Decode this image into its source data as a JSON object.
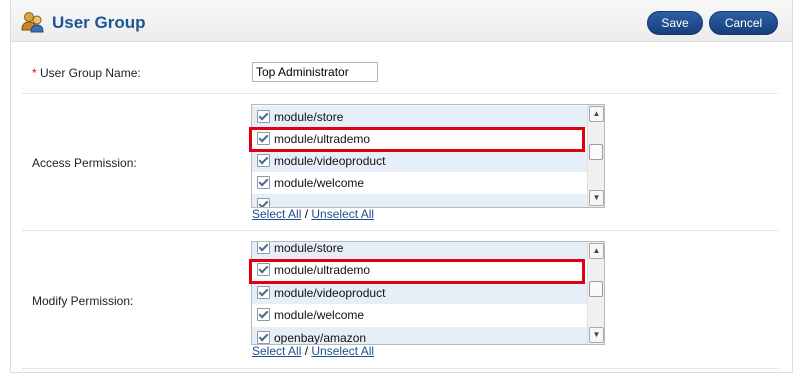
{
  "header": {
    "title": "User Group",
    "save_label": "Save",
    "cancel_label": "Cancel",
    "icon": "user-group-icon"
  },
  "form": {
    "name_field": {
      "required_marker": "*",
      "label": "User Group Name:",
      "value": "Top Administrator"
    },
    "access": {
      "label": "Access Permission:",
      "items": [
        {
          "label": "module/store",
          "checked": true
        },
        {
          "label": "module/ultrademo",
          "checked": true,
          "highlighted": true
        },
        {
          "label": "module/videoproduct",
          "checked": true
        },
        {
          "label": "module/welcome",
          "checked": true
        }
      ],
      "select_all": "Select All",
      "separator": "/",
      "unselect_all": "Unselect All"
    },
    "modify": {
      "label": "Modify Permission:",
      "items": [
        {
          "label": "module/store",
          "checked": true
        },
        {
          "label": "module/ultrademo",
          "checked": true,
          "highlighted": true
        },
        {
          "label": "module/videoproduct",
          "checked": true
        },
        {
          "label": "module/welcome",
          "checked": true
        },
        {
          "label": "openbay/amazon",
          "checked": true
        }
      ],
      "select_all": "Select All",
      "separator": "/",
      "unselect_all": "Unselect All"
    }
  },
  "colors": {
    "title": "#1d5694",
    "button": "#1e4c8e",
    "highlight_box": "#e00012",
    "row_stripe": "#e6eef7",
    "required": "#ff0000"
  }
}
